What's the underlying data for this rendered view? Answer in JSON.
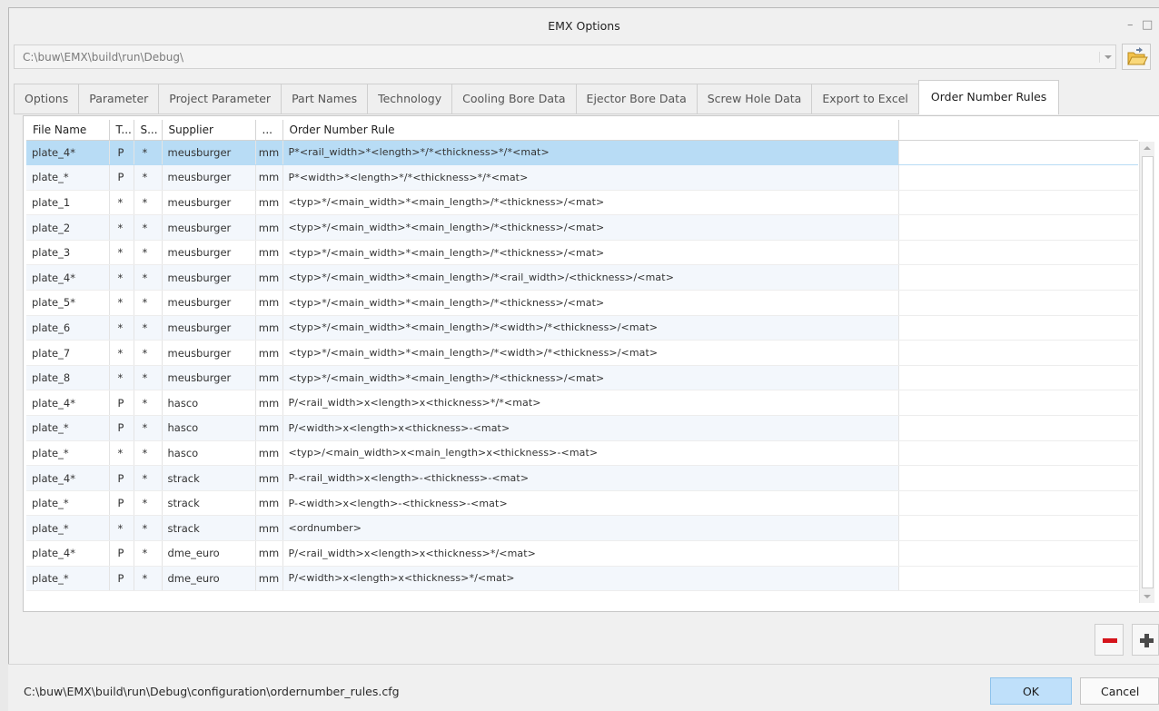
{
  "window": {
    "title": "EMX Options",
    "minimize_glyph": "–",
    "maximize_glyph": "□"
  },
  "path_field": {
    "value": "C:\\buw\\EMX\\build\\run\\Debug\\"
  },
  "tabs": [
    {
      "label": "Options"
    },
    {
      "label": "Parameter"
    },
    {
      "label": "Project Parameter"
    },
    {
      "label": "Part Names"
    },
    {
      "label": "Technology"
    },
    {
      "label": "Cooling Bore Data"
    },
    {
      "label": "Ejector Bore Data"
    },
    {
      "label": "Screw Hole Data"
    },
    {
      "label": "Export to Excel"
    },
    {
      "label": "Order Number Rules"
    }
  ],
  "active_tab": "Order Number Rules",
  "table": {
    "columns": [
      "File Name",
      "T...",
      "S...",
      "Supplier",
      "...",
      "Order Number Rule"
    ],
    "rows": [
      [
        "plate_4*",
        "P",
        "*",
        "meusburger",
        "mm",
        "P*<rail_width>*<length>*/*<thickness>*/*<mat>"
      ],
      [
        "plate_*",
        "P",
        "*",
        "meusburger",
        "mm",
        "P*<width>*<length>*/*<thickness>*/*<mat>"
      ],
      [
        "plate_1",
        "*",
        "*",
        "meusburger",
        "mm",
        "<typ>*/<main_width>*<main_length>/*<thickness>/<mat>"
      ],
      [
        "plate_2",
        "*",
        "*",
        "meusburger",
        "mm",
        "<typ>*/<main_width>*<main_length>/*<thickness>/<mat>"
      ],
      [
        "plate_3",
        "*",
        "*",
        "meusburger",
        "mm",
        "<typ>*/<main_width>*<main_length>/*<thickness>/<mat>"
      ],
      [
        "plate_4*",
        "*",
        "*",
        "meusburger",
        "mm",
        "<typ>*/<main_width>*<main_length>/*<rail_width>/<thickness>/<mat>"
      ],
      [
        "plate_5*",
        "*",
        "*",
        "meusburger",
        "mm",
        "<typ>*/<main_width>*<main_length>/*<thickness>/<mat>"
      ],
      [
        "plate_6",
        "*",
        "*",
        "meusburger",
        "mm",
        "<typ>*/<main_width>*<main_length>/*<width>/*<thickness>/<mat>"
      ],
      [
        "plate_7",
        "*",
        "*",
        "meusburger",
        "mm",
        "<typ>*/<main_width>*<main_length>/*<width>/*<thickness>/<mat>"
      ],
      [
        "plate_8",
        "*",
        "*",
        "meusburger",
        "mm",
        "<typ>*/<main_width>*<main_length>/*<thickness>/<mat>"
      ],
      [
        "plate_4*",
        "P",
        "*",
        "hasco",
        "mm",
        "P/<rail_width>x<length>x<thickness>*/*<mat>"
      ],
      [
        "plate_*",
        "P",
        "*",
        "hasco",
        "mm",
        "P/<width>x<length>x<thickness>-<mat>"
      ],
      [
        "plate_*",
        "*",
        "*",
        "hasco",
        "mm",
        "<typ>/<main_width>x<main_length>x<thickness>-<mat>"
      ],
      [
        "plate_4*",
        "P",
        "*",
        "strack",
        "mm",
        "P-<rail_width>x<length>-<thickness>-<mat>"
      ],
      [
        "plate_*",
        "P",
        "*",
        "strack",
        "mm",
        "P-<width>x<length>-<thickness>-<mat>"
      ],
      [
        "plate_*",
        "*",
        "*",
        "strack",
        "mm",
        "<ordnumber>"
      ],
      [
        "plate_4*",
        "P",
        "*",
        "dme_euro",
        "mm",
        "P/<rail_width>x<length>x<thickness>*/<mat>"
      ],
      [
        "plate_*",
        "P",
        "*",
        "dme_euro",
        "mm",
        "P/<width>x<length>x<thickness>*/<mat>"
      ]
    ],
    "selected_row": 0
  },
  "icons": {
    "folder": "folder-open-icon",
    "remove": "minus-icon",
    "add": "plus-icon"
  },
  "colors": {
    "selection": "#b8dcf5",
    "alt_row": "#f3f7fc",
    "ok_button": "#bfe0fa",
    "remove_icon": "#d5141b"
  },
  "status": {
    "config_path": "C:\\buw\\EMX\\build\\run\\Debug\\configuration\\ordernumber_rules.cfg"
  },
  "buttons": {
    "ok": "OK",
    "cancel": "Cancel"
  }
}
